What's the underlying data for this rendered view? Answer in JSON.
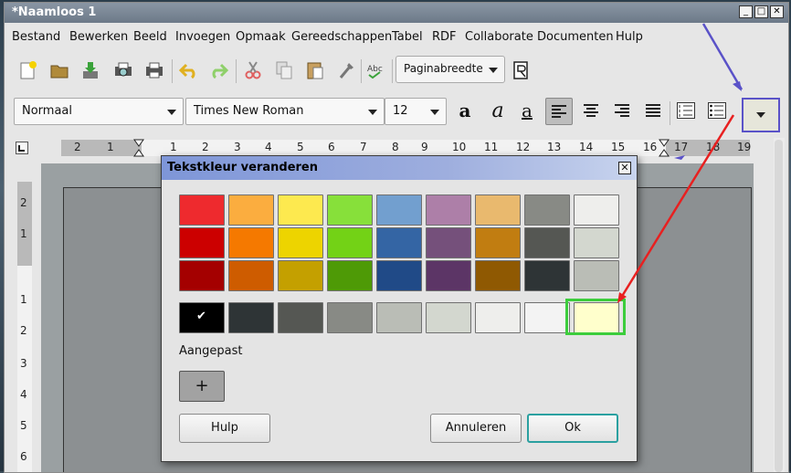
{
  "window": {
    "title": "*Naamloos 1",
    "min_label": "_",
    "max_label": "□",
    "close_label": "✕"
  },
  "menubar": {
    "items": [
      "Bestand",
      "Bewerken",
      "Beeld",
      "Invoegen",
      "Opmaak",
      "Gereedschappen",
      "Tabel",
      "RDF",
      "Collaborate",
      "Documenten",
      "Hulp"
    ]
  },
  "toolbar": {
    "zoom_value": "Paginabreedte",
    "icons": [
      "new-document-icon",
      "open-folder-icon",
      "save-icon",
      "print-preview-icon",
      "print-icon",
      "undo-icon",
      "redo-icon",
      "cut-icon",
      "copy-icon",
      "paste-icon",
      "format-paintbrush-icon",
      "spellcheck-icon"
    ]
  },
  "formatting": {
    "style": "Normaal",
    "font": "Times New Roman",
    "size": "12",
    "bold_glyph": "a",
    "italic_glyph": "a",
    "underline_glyph": "a"
  },
  "ruler": {
    "numbers": [
      "2",
      "1",
      "1",
      "2",
      "3",
      "4",
      "5",
      "6",
      "7",
      "8",
      "9",
      "10",
      "11",
      "12",
      "13",
      "14",
      "15",
      "16",
      "17",
      "18",
      "19"
    ],
    "vnumbers": [
      "2",
      "1",
      "1",
      "2",
      "3",
      "4",
      "5",
      "6"
    ]
  },
  "dialog": {
    "title": "Tekstkleur veranderen",
    "custom_label": "Aangepast",
    "add_label": "+",
    "help_label": "Hulp",
    "cancel_label": "Annuleren",
    "ok_label": "Ok",
    "checkmark": "✔",
    "palette_rows": [
      [
        "#ee2a2e",
        "#fbad3f",
        "#fde94f",
        "#87e03a",
        "#729fcf",
        "#ad7fa8",
        "#e9b96e",
        "#888a85",
        "#eeeeec"
      ],
      [
        "#cc0000",
        "#f57900",
        "#edd400",
        "#73d216",
        "#3465a4",
        "#75507b",
        "#c17d11",
        "#555753",
        "#d3d7cf"
      ],
      [
        "#a40000",
        "#ce5c00",
        "#c4a000",
        "#4e9a06",
        "#204a87",
        "#5c3566",
        "#8f5902",
        "#2e3436",
        "#babdb6"
      ]
    ],
    "grey_row": [
      "#000000",
      "#2e3436",
      "#555753",
      "#888a85",
      "#babdb6",
      "#d3d7cf",
      "#eeeeec",
      "#f3f3f3",
      "#ffffcc"
    ],
    "selected_color": "#ffffcc"
  },
  "colors": {
    "annotation_arrow_red": "#e82020",
    "annotation_arrow_blue": "#5a52c8",
    "highlight_green": "#3ccd3c"
  }
}
